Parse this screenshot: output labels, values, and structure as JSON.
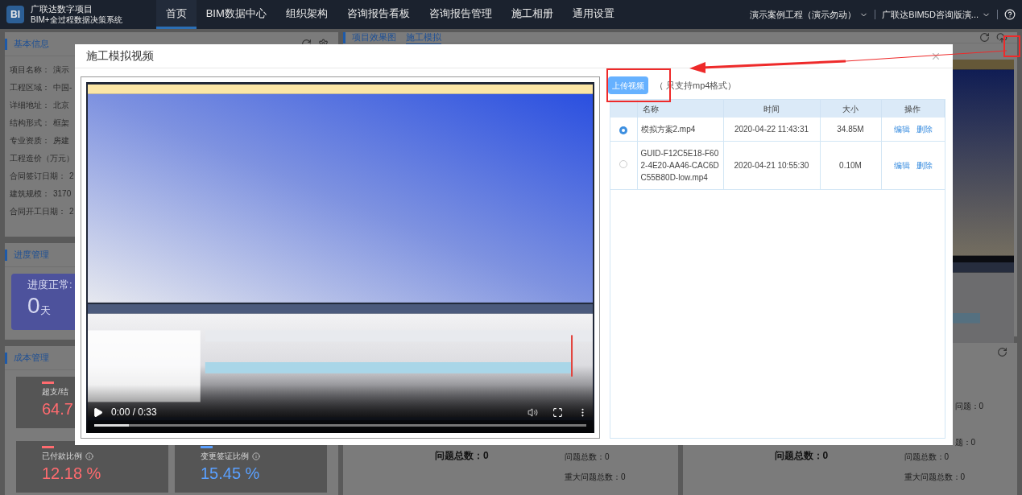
{
  "topbar": {
    "logo": "BI",
    "title": "广联达数字项目",
    "subtitle": "BIM+全过程数据决策系统",
    "nav": [
      {
        "label": "首页",
        "selected": true
      },
      {
        "label": "BIM数据中心",
        "selected": false
      },
      {
        "label": "组织架构",
        "selected": false
      },
      {
        "label": "咨询报告看板",
        "selected": false
      },
      {
        "label": "咨询报告管理",
        "selected": false
      },
      {
        "label": "施工相册",
        "selected": false
      },
      {
        "label": "通用设置",
        "selected": false
      }
    ],
    "project": "演示案例工程（演示勿动）",
    "account": "广联达BIM5D咨询版演..."
  },
  "basic_info": {
    "title": "基本信息",
    "rows": [
      {
        "label": "项目名称：",
        "value": "演示"
      },
      {
        "label": "工程区域：",
        "value": "中国-"
      },
      {
        "label": "详细地址：",
        "value": "北京"
      },
      {
        "label": "结构形式：",
        "value": "框架"
      },
      {
        "label": "专业资质：",
        "value": "房建"
      },
      {
        "label": "工程造价（万元）"
      },
      {
        "label": "合同签订日期：",
        "value": "2"
      },
      {
        "label": "建筑规模：",
        "value": "3170"
      },
      {
        "label": "合同开工日期：",
        "value": "2"
      }
    ]
  },
  "progress": {
    "title": "进度管理",
    "label": "进度正常:",
    "value": "0",
    "unit": "天"
  },
  "cost": {
    "title": "成本管理",
    "cards": [
      {
        "label": "超支/结",
        "value": "64.7",
        "color": "#ff6b6f",
        "info": false
      },
      {
        "label": "已付款比例",
        "value": "12.18 %",
        "color": "#ff6b6f",
        "info": true
      },
      {
        "label": "变更签证比例",
        "value": "15.45 %",
        "color": "#5aa0ff",
        "info": true
      }
    ]
  },
  "effect": {
    "title": "项目效果图",
    "tab": "施工模拟"
  },
  "quality": {
    "total": "问题总数：0",
    "stats": [
      "问题总数：0",
      "重大问题总数：0"
    ]
  },
  "safety": {
    "total": "问题总数：0",
    "partial": [
      "问题：0",
      "题：0"
    ],
    "stats": [
      "问题总数：0",
      "重大问题总数：0"
    ]
  },
  "modal": {
    "title": "施工模拟视频",
    "video": {
      "time": "0:00 / 0:33",
      "level": 0.07
    },
    "upload": "上传视频",
    "note": "（ 只支持mp4格式）",
    "table": {
      "columns": [
        "名称",
        "时间",
        "大小",
        "操作"
      ],
      "rows": [
        {
          "selected": true,
          "name": "模拟方案2.mp4",
          "time": "2020-04-22 11:43:31",
          "size": "34.85M",
          "actions": [
            "编辑",
            "删除"
          ]
        },
        {
          "selected": false,
          "name": "GUID-F12C5E18-F602-4E20-AA46-CAC6DC55B80D-low.mp4",
          "time": "2020-04-21 10:55:30",
          "size": "0.10M",
          "actions": [
            "编辑",
            "删除"
          ]
        }
      ]
    }
  }
}
